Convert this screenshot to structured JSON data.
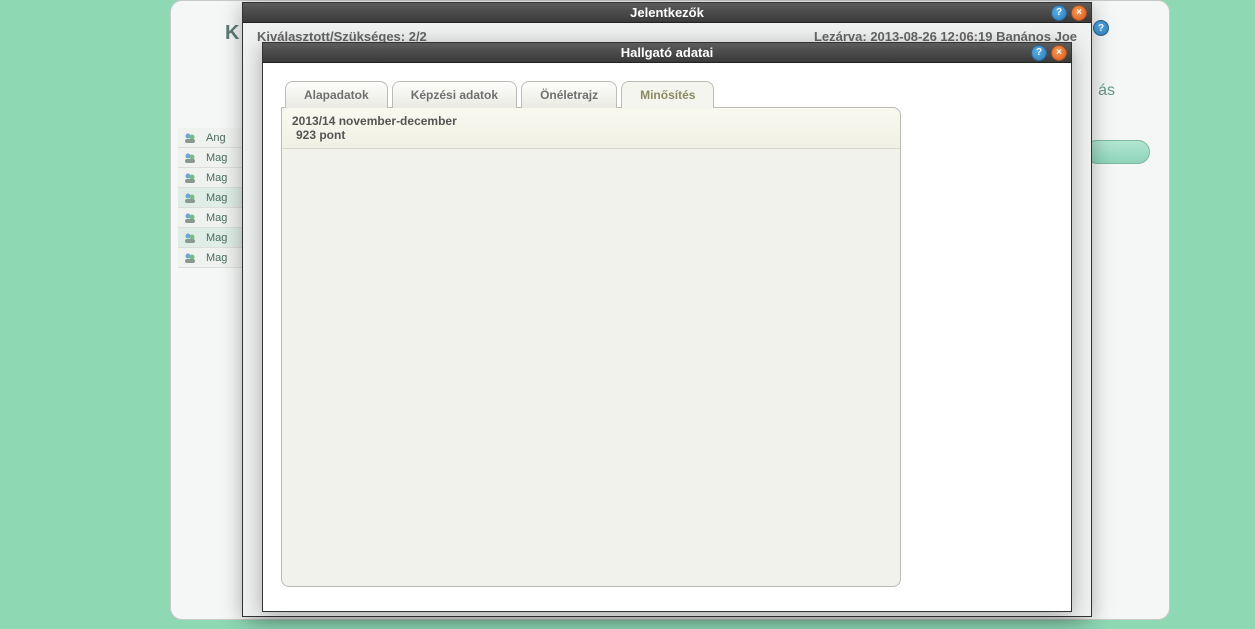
{
  "background": {
    "header_letter": "K",
    "right_text": "ás",
    "sidebar": [
      "Ang",
      "Mag",
      "Mag",
      "Mag",
      "Mag",
      "Mag",
      "Mag"
    ]
  },
  "modal1": {
    "title": "Jelentkezők",
    "info_left": "Kiválasztott/Szükséges: 2/2",
    "info_right": "Lezárva: 2013-08-26 12:06:19 Banános Joe"
  },
  "modal2": {
    "title": "Hallgató adatai",
    "tabs": [
      {
        "label": "Alapadatok",
        "active": false
      },
      {
        "label": "Képzési adatok",
        "active": false
      },
      {
        "label": "Önéletrajz",
        "active": false
      },
      {
        "label": "Minősítés",
        "active": true
      }
    ],
    "data": {
      "period": "2013/14 november-december",
      "score": "923 pont"
    }
  }
}
